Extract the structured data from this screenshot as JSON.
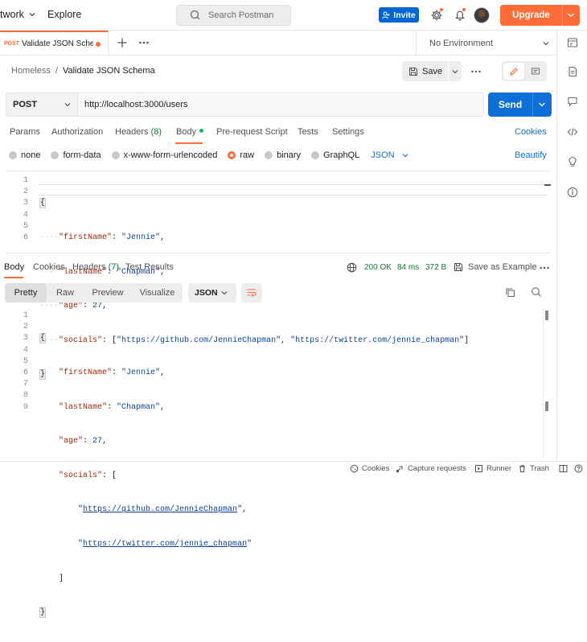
{
  "topbar": {
    "workspace_label": "twork",
    "explore_label": "Explore",
    "search_placeholder": "Search Postman",
    "invite_label": "Invite",
    "upgrade_label": "Upgrade"
  },
  "tab": {
    "method": "POST",
    "title": "Validate JSON Schem"
  },
  "environment": "No Environment",
  "breadcrumb": {
    "parent": "Homeless",
    "separator": "/",
    "current": "Validate JSON Schema"
  },
  "save_label": "Save",
  "request": {
    "method": "POST",
    "url": "http://localhost:3000/users",
    "send_label": "Send"
  },
  "request_tabs": {
    "params": "Params",
    "authorization": "Authorization",
    "headers": "Headers",
    "headers_count": "(8)",
    "body": "Body",
    "prerequest": "Pre-request Script",
    "tests": "Tests",
    "settings": "Settings",
    "cookies": "Cookies"
  },
  "body_types": {
    "none": "none",
    "form_data": "form-data",
    "urlencoded": "x-www-form-urlencoded",
    "raw": "raw",
    "binary": "binary",
    "graphql": "GraphQL",
    "format": "JSON",
    "beautify": "Beautify"
  },
  "request_body": {
    "line_numbers": [
      "1",
      "2",
      "3",
      "4",
      "5",
      "6"
    ],
    "first_name_key": "\"firstName\"",
    "first_name_val": "\"Jennie\"",
    "last_name_key": "\"lastName\"",
    "last_name_val": "\"Chapman\"",
    "age_key": "\"age\"",
    "age_val": "27",
    "socials_key": "\"socials\"",
    "social_1": "\"https://github.com/JennieChapman\"",
    "social_2": "\"https://twitter.com/jennie_chapman\""
  },
  "response_tabs": {
    "body": "Body",
    "cookies": "Cookies",
    "headers": "Headers",
    "headers_count": "(7)",
    "test_results": "Test Results"
  },
  "response_status": {
    "status": "200 OK",
    "time": "84 ms",
    "size": "372 B",
    "save_example": "Save as Example"
  },
  "response_view": {
    "pretty": "Pretty",
    "raw": "Raw",
    "preview": "Preview",
    "visualize": "Visualize",
    "format": "JSON"
  },
  "response_body": {
    "line_numbers": [
      "1",
      "2",
      "3",
      "4",
      "5",
      "6",
      "7",
      "8",
      "9"
    ],
    "first_name_key": "\"firstName\"",
    "first_name_val": "\"Jennie\"",
    "last_name_key": "\"lastName\"",
    "last_name_val": "\"Chapman\"",
    "age_key": "\"age\"",
    "age_val": "27",
    "socials_key": "\"socials\"",
    "social_1": "https://github.com/JennieChapman",
    "social_2": "https://twitter.com/jennie_chapman"
  },
  "footer": {
    "cookies": "Cookies",
    "capture": "Capture requests",
    "runner": "Runner",
    "trash": "Trash"
  },
  "colors": {
    "accent": "#ff6c37",
    "send": "#0d6fd8",
    "status_ok": "#0a7d2c",
    "json_key": "#a0260a",
    "json_value": "#0b4296"
  }
}
